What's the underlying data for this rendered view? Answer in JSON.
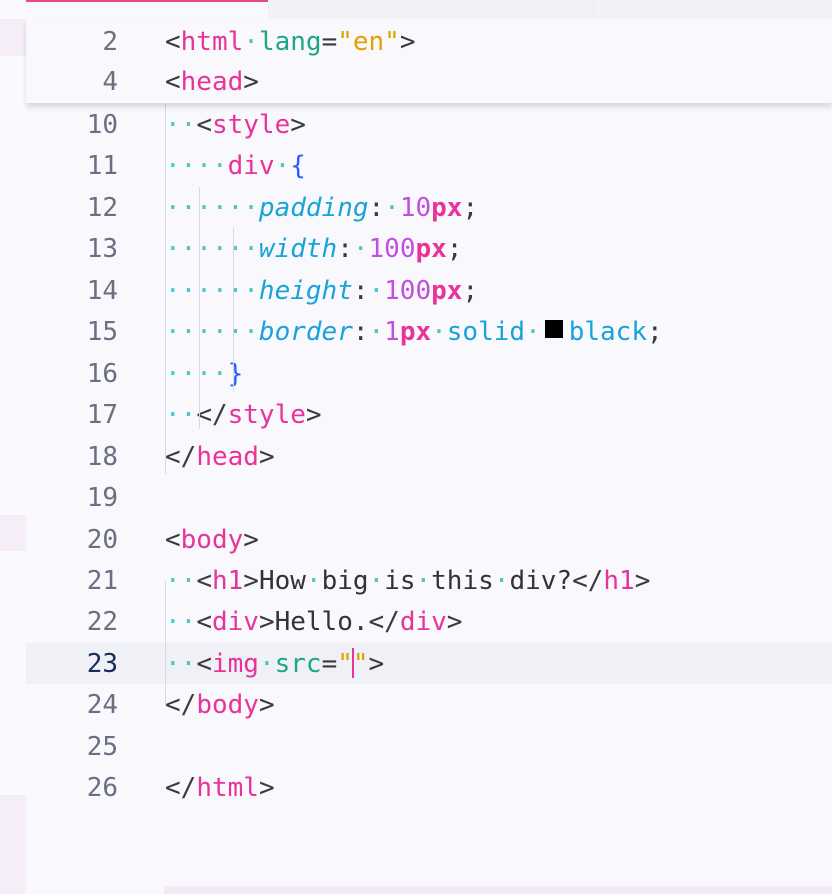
{
  "sticky_lines": [
    {
      "num": "2",
      "tokens": [
        [
          "t-p",
          "<"
        ],
        [
          "t-tag",
          "html"
        ],
        [
          "ws",
          "·"
        ],
        [
          "t-attr",
          "lang"
        ],
        [
          "t-p",
          "="
        ],
        [
          "t-str",
          "\"en\""
        ],
        [
          "t-p",
          ">"
        ]
      ]
    },
    {
      "num": "4",
      "tokens": [
        [
          "t-p",
          "<"
        ],
        [
          "t-tag",
          "head"
        ],
        [
          "t-p",
          ">"
        ]
      ]
    }
  ],
  "lines": [
    {
      "num": "10",
      "indent": "··",
      "tokens": [
        [
          "t-p",
          "<"
        ],
        [
          "t-tag",
          "style"
        ],
        [
          "t-p",
          ">"
        ]
      ]
    },
    {
      "num": "11",
      "indent": "····",
      "tokens": [
        [
          "t-sel",
          "div"
        ],
        [
          "ws",
          "·"
        ],
        [
          "t-brace",
          "{"
        ]
      ]
    },
    {
      "num": "12",
      "indent": "······",
      "tokens": [
        [
          "t-prop",
          "padding"
        ],
        [
          "t-p",
          ":"
        ],
        [
          "ws",
          "·"
        ],
        [
          "t-num",
          "10"
        ],
        [
          "t-unit",
          "px"
        ],
        [
          "t-p",
          ";"
        ]
      ]
    },
    {
      "num": "13",
      "indent": "······",
      "tokens": [
        [
          "t-prop",
          "width"
        ],
        [
          "t-p",
          ":"
        ],
        [
          "ws",
          "·"
        ],
        [
          "t-num",
          "100"
        ],
        [
          "t-unit",
          "px"
        ],
        [
          "t-p",
          ";"
        ]
      ]
    },
    {
      "num": "14",
      "indent": "······",
      "tokens": [
        [
          "t-prop",
          "height"
        ],
        [
          "t-p",
          ":"
        ],
        [
          "ws",
          "·"
        ],
        [
          "t-num",
          "100"
        ],
        [
          "t-unit",
          "px"
        ],
        [
          "t-p",
          ";"
        ]
      ]
    },
    {
      "num": "15",
      "indent": "······",
      "tokens": [
        [
          "t-prop",
          "border"
        ],
        [
          "t-p",
          ":"
        ],
        [
          "ws",
          "·"
        ],
        [
          "t-num",
          "1"
        ],
        [
          "t-unit",
          "px"
        ],
        [
          "ws",
          "·"
        ],
        [
          "t-kw",
          "solid"
        ],
        [
          "ws",
          "·"
        ],
        [
          "swatch",
          ""
        ],
        [
          "t-kw",
          "black"
        ],
        [
          "t-p",
          ";"
        ]
      ]
    },
    {
      "num": "16",
      "indent": "····",
      "tokens": [
        [
          "t-brace",
          "}"
        ]
      ]
    },
    {
      "num": "17",
      "indent": "··",
      "tokens": [
        [
          "t-p",
          "</"
        ],
        [
          "t-tag",
          "style"
        ],
        [
          "t-p",
          ">"
        ]
      ]
    },
    {
      "num": "18",
      "indent": "",
      "tokens": [
        [
          "t-p",
          "</"
        ],
        [
          "t-tag",
          "head"
        ],
        [
          "t-p",
          ">"
        ]
      ]
    },
    {
      "num": "19",
      "indent": "",
      "tokens": []
    },
    {
      "num": "20",
      "indent": "",
      "tokens": [
        [
          "t-p",
          "<"
        ],
        [
          "t-tag",
          "body"
        ],
        [
          "t-p",
          ">"
        ]
      ]
    },
    {
      "num": "21",
      "indent": "··",
      "tokens": [
        [
          "t-p",
          "<"
        ],
        [
          "t-tag",
          "h1"
        ],
        [
          "t-p",
          ">"
        ],
        [
          "t-text",
          "How"
        ],
        [
          "ws",
          "·"
        ],
        [
          "t-text",
          "big"
        ],
        [
          "ws",
          "·"
        ],
        [
          "t-text",
          "is"
        ],
        [
          "ws",
          "·"
        ],
        [
          "t-text",
          "this"
        ],
        [
          "ws",
          "·"
        ],
        [
          "t-text",
          "div?"
        ],
        [
          "t-p",
          "</"
        ],
        [
          "t-tag",
          "h1"
        ],
        [
          "t-p",
          ">"
        ]
      ]
    },
    {
      "num": "22",
      "indent": "··",
      "tokens": [
        [
          "t-p",
          "<"
        ],
        [
          "t-tag",
          "div"
        ],
        [
          "t-p",
          ">"
        ],
        [
          "t-text",
          "Hello."
        ],
        [
          "t-p",
          "</"
        ],
        [
          "t-tag",
          "div"
        ],
        [
          "t-p",
          ">"
        ]
      ]
    },
    {
      "num": "23",
      "indent": "··",
      "current": true,
      "tokens": [
        [
          "t-p",
          "<"
        ],
        [
          "t-tag",
          "img"
        ],
        [
          "ws",
          "·"
        ],
        [
          "t-attr",
          "src"
        ],
        [
          "t-p",
          "="
        ],
        [
          "t-str",
          "\""
        ],
        [
          "caret",
          ""
        ],
        [
          "t-str",
          "\""
        ],
        [
          "t-p",
          ">"
        ]
      ]
    },
    {
      "num": "24",
      "indent": "",
      "tokens": [
        [
          "t-p",
          "</"
        ],
        [
          "t-tag",
          "body"
        ],
        [
          "t-p",
          ">"
        ]
      ]
    },
    {
      "num": "25",
      "indent": "",
      "tokens": []
    },
    {
      "num": "26",
      "indent": "",
      "tokens": [
        [
          "t-p",
          "</"
        ],
        [
          "t-tag",
          "html"
        ],
        [
          "t-p",
          ">"
        ]
      ]
    }
  ]
}
